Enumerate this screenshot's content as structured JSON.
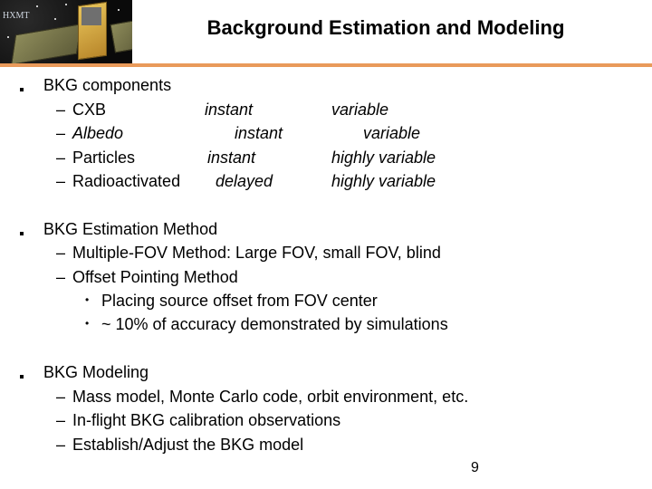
{
  "slide": {
    "title": "Background Estimation and Modeling",
    "logo_text": "HXMT",
    "page_number": "9",
    "accent_color": "#e99a5a"
  },
  "sections": [
    {
      "heading": "BKG components",
      "components": [
        {
          "name": "CXB",
          "timing": "instant",
          "variability": "variable"
        },
        {
          "name": "Albedo",
          "timing": "instant",
          "variability": "variable"
        },
        {
          "name": "Particles",
          "timing": "instant",
          "variability": "highly variable"
        },
        {
          "name": "Radioactivated",
          "timing": "delayed",
          "variability": "highly variable"
        }
      ]
    },
    {
      "heading": "BKG Estimation Method",
      "items": [
        {
          "text": "Multiple-FOV Method:  Large FOV, small FOV, blind"
        },
        {
          "text": "Offset Pointing Method",
          "subitems": [
            "Placing source offset from FOV center",
            "~ 10% of accuracy demonstrated by simulations"
          ]
        }
      ]
    },
    {
      "heading": "BKG Modeling",
      "items": [
        {
          "text": "Mass model, Monte Carlo code, orbit environment, etc."
        },
        {
          "text": "In-flight BKG calibration observations"
        },
        {
          "text": "Establish/Adjust the BKG model"
        }
      ]
    }
  ],
  "glyphs": {
    "dash": "–",
    "dot": "•"
  }
}
